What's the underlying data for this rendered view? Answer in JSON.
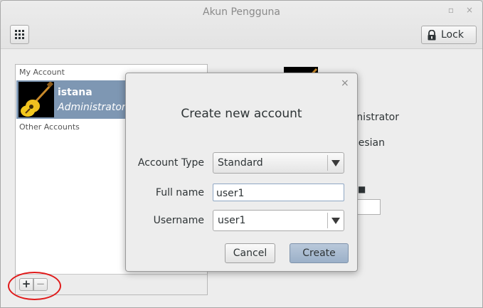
{
  "window": {
    "title": "Akun Pengguna",
    "minimize_glyph": "▫",
    "close_glyph": "×",
    "lock_label": "Lock"
  },
  "accounts_panel": {
    "my_account_header": "My Account",
    "other_accounts_header": "Other Accounts",
    "selected": {
      "name": "istana",
      "role": "Administrator"
    },
    "add_label": "+",
    "remove_label": "−"
  },
  "detail": {
    "role_text": "Administrator",
    "language_text": "Indonesian",
    "password_glyph": "■"
  },
  "dialog": {
    "close_glyph": "×",
    "title": "Create new account",
    "account_type_label": "Account Type",
    "account_type_value": "Standard",
    "full_name_label": "Full name",
    "full_name_value": "user1",
    "username_label": "Username",
    "username_value": "user1",
    "cancel_label": "Cancel",
    "create_label": "Create"
  },
  "icons": {
    "apps": "grid-icon",
    "lock": "lock-icon",
    "avatar": "guitar-avatar-icon",
    "dropdown": "chevron-down-icon"
  },
  "colors": {
    "selection": "#7e97b3",
    "highlight_circle": "#e01a1a",
    "default_button": "#9bb0c8"
  }
}
